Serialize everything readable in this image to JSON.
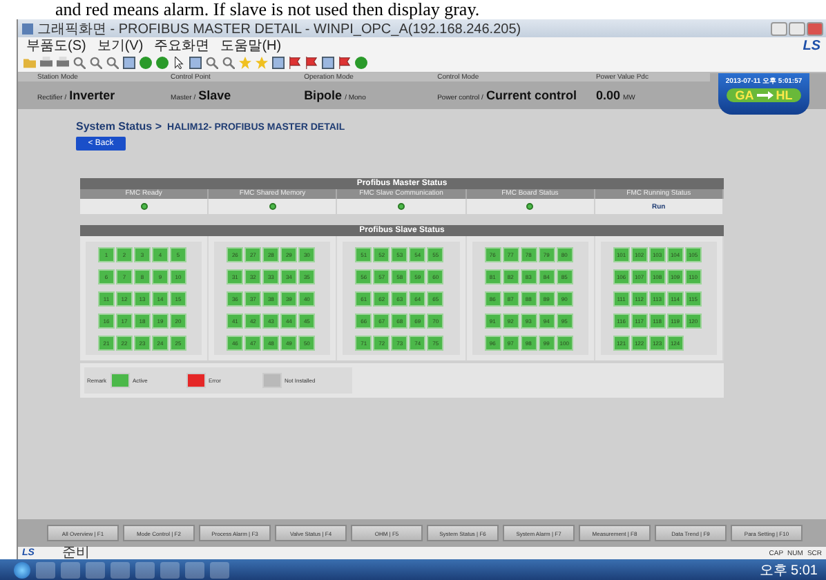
{
  "caption": "and red means alarm. If slave is not used then display gray.",
  "window": {
    "title": "그래픽화면 - PROFIBUS MASTER DETAIL - WINPI_OPC_A(192.168.246.205)"
  },
  "menu": [
    "부품도(S)",
    "보기(V)",
    "주요화면",
    "도움말(H)"
  ],
  "brand": "LS",
  "header_fields": [
    {
      "label": "Station Mode",
      "prefix": "Rectifier /",
      "value": "Inverter"
    },
    {
      "label": "Control Point",
      "prefix": "Master /",
      "value": "Slave"
    },
    {
      "label": "Operation Mode",
      "value": "Bipole",
      "unit": "/ Mono"
    },
    {
      "label": "Control Mode",
      "prefix": "Power control /",
      "value": "Current control"
    },
    {
      "label": "Power Value Pdc",
      "value": "0.00",
      "unit": "MW"
    }
  ],
  "clock_badge": {
    "datetime": "2013-07-11 오후 5:01:57",
    "from": "GA",
    "to": "HL"
  },
  "breadcrumb": {
    "section": "System Status >",
    "page": "HALIM12- PROFIBUS MASTER DETAIL"
  },
  "back_button": "< Back",
  "master": {
    "title": "Profibus Master Status",
    "columns": [
      "FMC Ready",
      "FMC Shared Memory",
      "FMC Slave Communication",
      "FMC Board Status",
      "FMC Running Status"
    ],
    "cells": [
      {
        "kind": "led",
        "color": "#4cb84a"
      },
      {
        "kind": "led",
        "color": "#4cb84a"
      },
      {
        "kind": "led",
        "color": "#4cb84a"
      },
      {
        "kind": "led",
        "color": "#4cb84a"
      },
      {
        "kind": "text",
        "text": "Run"
      }
    ]
  },
  "slave": {
    "title": "Profibus Slave Status",
    "groups": [
      {
        "slaves": [
          {
            "label": "1",
            "color": "#4cb84a"
          },
          {
            "label": "2",
            "color": "#4cb84a"
          },
          {
            "label": "3",
            "color": "#4cb84a"
          },
          {
            "label": "4",
            "color": "#4cb84a"
          },
          {
            "label": "5",
            "color": "#4cb84a"
          },
          {
            "label": "6",
            "color": "#4cb84a"
          },
          {
            "label": "7",
            "color": "#4cb84a"
          },
          {
            "label": "8",
            "color": "#4cb84a"
          },
          {
            "label": "9",
            "color": "#4cb84a"
          },
          {
            "label": "10",
            "color": "#4cb84a"
          },
          {
            "label": "11",
            "color": "#4cb84a"
          },
          {
            "label": "12",
            "color": "#4cb84a"
          },
          {
            "label": "13",
            "color": "#4cb84a"
          },
          {
            "label": "14",
            "color": "#4cb84a"
          },
          {
            "label": "15",
            "color": "#4cb84a"
          },
          {
            "label": "16",
            "color": "#4cb84a"
          },
          {
            "label": "17",
            "color": "#4cb84a"
          },
          {
            "label": "18",
            "color": "#4cb84a"
          },
          {
            "label": "19",
            "color": "#4cb84a"
          },
          {
            "label": "20",
            "color": "#4cb84a"
          },
          {
            "label": "21",
            "color": "#4cb84a"
          },
          {
            "label": "22",
            "color": "#4cb84a"
          },
          {
            "label": "23",
            "color": "#4cb84a"
          },
          {
            "label": "24",
            "color": "#4cb84a"
          },
          {
            "label": "25",
            "color": "#4cb84a"
          }
        ]
      },
      {
        "slaves": [
          {
            "label": "26",
            "color": "#4cb84a"
          },
          {
            "label": "27",
            "color": "#4cb84a"
          },
          {
            "label": "28",
            "color": "#4cb84a"
          },
          {
            "label": "29",
            "color": "#4cb84a"
          },
          {
            "label": "30",
            "color": "#4cb84a"
          },
          {
            "label": "31",
            "color": "#4cb84a"
          },
          {
            "label": "32",
            "color": "#4cb84a"
          },
          {
            "label": "33",
            "color": "#4cb84a"
          },
          {
            "label": "34",
            "color": "#4cb84a"
          },
          {
            "label": "35",
            "color": "#4cb84a"
          },
          {
            "label": "36",
            "color": "#4cb84a"
          },
          {
            "label": "37",
            "color": "#4cb84a"
          },
          {
            "label": "38",
            "color": "#4cb84a"
          },
          {
            "label": "39",
            "color": "#4cb84a"
          },
          {
            "label": "40",
            "color": "#4cb84a"
          },
          {
            "label": "41",
            "color": "#4cb84a"
          },
          {
            "label": "42",
            "color": "#4cb84a"
          },
          {
            "label": "43",
            "color": "#4cb84a"
          },
          {
            "label": "44",
            "color": "#4cb84a"
          },
          {
            "label": "45",
            "color": "#4cb84a"
          },
          {
            "label": "46",
            "color": "#4cb84a"
          },
          {
            "label": "47",
            "color": "#4cb84a"
          },
          {
            "label": "48",
            "color": "#4cb84a"
          },
          {
            "label": "49",
            "color": "#4cb84a"
          },
          {
            "label": "50",
            "color": "#4cb84a"
          }
        ]
      },
      {
        "slaves": [
          {
            "label": "51",
            "color": "#4cb84a"
          },
          {
            "label": "52",
            "color": "#4cb84a"
          },
          {
            "label": "53",
            "color": "#4cb84a"
          },
          {
            "label": "54",
            "color": "#4cb84a"
          },
          {
            "label": "55",
            "color": "#4cb84a"
          },
          {
            "label": "56",
            "color": "#4cb84a"
          },
          {
            "label": "57",
            "color": "#4cb84a"
          },
          {
            "label": "58",
            "color": "#4cb84a"
          },
          {
            "label": "59",
            "color": "#4cb84a"
          },
          {
            "label": "60",
            "color": "#4cb84a"
          },
          {
            "label": "61",
            "color": "#4cb84a"
          },
          {
            "label": "62",
            "color": "#4cb84a"
          },
          {
            "label": "63",
            "color": "#4cb84a"
          },
          {
            "label": "64",
            "color": "#4cb84a"
          },
          {
            "label": "65",
            "color": "#4cb84a"
          },
          {
            "label": "66",
            "color": "#4cb84a"
          },
          {
            "label": "67",
            "color": "#4cb84a"
          },
          {
            "label": "68",
            "color": "#4cb84a"
          },
          {
            "label": "69",
            "color": "#4cb84a"
          },
          {
            "label": "70",
            "color": "#4cb84a"
          },
          {
            "label": "71",
            "color": "#4cb84a"
          },
          {
            "label": "72",
            "color": "#4cb84a"
          },
          {
            "label": "73",
            "color": "#4cb84a"
          },
          {
            "label": "74",
            "color": "#4cb84a"
          },
          {
            "label": "75",
            "color": "#4cb84a"
          }
        ]
      },
      {
        "slaves": [
          {
            "label": "76",
            "color": "#4cb84a"
          },
          {
            "label": "77",
            "color": "#4cb84a"
          },
          {
            "label": "78",
            "color": "#4cb84a"
          },
          {
            "label": "79",
            "color": "#4cb84a"
          },
          {
            "label": "80",
            "color": "#4cb84a"
          },
          {
            "label": "81",
            "color": "#4cb84a"
          },
          {
            "label": "82",
            "color": "#4cb84a"
          },
          {
            "label": "83",
            "color": "#4cb84a"
          },
          {
            "label": "84",
            "color": "#4cb84a"
          },
          {
            "label": "85",
            "color": "#4cb84a"
          },
          {
            "label": "86",
            "color": "#4cb84a"
          },
          {
            "label": "87",
            "color": "#4cb84a"
          },
          {
            "label": "88",
            "color": "#4cb84a"
          },
          {
            "label": "89",
            "color": "#4cb84a"
          },
          {
            "label": "90",
            "color": "#4cb84a"
          },
          {
            "label": "91",
            "color": "#4cb84a"
          },
          {
            "label": "92",
            "color": "#4cb84a"
          },
          {
            "label": "93",
            "color": "#4cb84a"
          },
          {
            "label": "94",
            "color": "#4cb84a"
          },
          {
            "label": "95",
            "color": "#4cb84a"
          },
          {
            "label": "96",
            "color": "#4cb84a"
          },
          {
            "label": "97",
            "color": "#4cb84a"
          },
          {
            "label": "98",
            "color": "#4cb84a"
          },
          {
            "label": "99",
            "color": "#4cb84a"
          },
          {
            "label": "100",
            "color": "#4cb84a"
          }
        ]
      },
      {
        "slaves": [
          {
            "label": "101",
            "color": "#4cb84a"
          },
          {
            "label": "102",
            "color": "#4cb84a"
          },
          {
            "label": "103",
            "color": "#4cb84a"
          },
          {
            "label": "104",
            "color": "#4cb84a"
          },
          {
            "label": "105",
            "color": "#4cb84a"
          },
          {
            "label": "106",
            "color": "#4cb84a"
          },
          {
            "label": "107",
            "color": "#4cb84a"
          },
          {
            "label": "108",
            "color": "#4cb84a"
          },
          {
            "label": "109",
            "color": "#4cb84a"
          },
          {
            "label": "110",
            "color": "#4cb84a"
          },
          {
            "label": "111",
            "color": "#4cb84a"
          },
          {
            "label": "112",
            "color": "#4cb84a"
          },
          {
            "label": "113",
            "color": "#4cb84a"
          },
          {
            "label": "114",
            "color": "#4cb84a"
          },
          {
            "label": "115",
            "color": "#4cb84a"
          },
          {
            "label": "116",
            "color": "#4cb84a"
          },
          {
            "label": "117",
            "color": "#4cb84a"
          },
          {
            "label": "118",
            "color": "#4cb84a"
          },
          {
            "label": "119",
            "color": "#4cb84a"
          },
          {
            "label": "120",
            "color": "#4cb84a"
          },
          {
            "label": "121",
            "color": "#4cb84a"
          },
          {
            "label": "122",
            "color": "#4cb84a"
          },
          {
            "label": "123",
            "color": "#4cb84a"
          },
          {
            "label": "124",
            "color": "#4cb84a"
          }
        ]
      }
    ]
  },
  "legend": {
    "title": "Remark",
    "items": [
      {
        "label": "Active",
        "color": "#4cb84a"
      },
      {
        "label": "Error",
        "color": "#e52727"
      },
      {
        "label": "Not Installed",
        "color": "#b9b9b9"
      }
    ]
  },
  "function_keys": [
    "All Overview | F1",
    "Mode Control | F2",
    "Process Alarm | F3",
    "Valve Status | F4",
    "OHM | F5",
    "System Status | F6",
    "System Alarm | F7",
    "Measurement | F8",
    "Data Trend | F9",
    "Para Setting | F10"
  ],
  "status_bar": {
    "brand": "LS",
    "message": "준비",
    "indicators": [
      "CAP",
      "NUM",
      "SCR"
    ]
  },
  "taskbar": {
    "clock": "오후 5:01"
  }
}
